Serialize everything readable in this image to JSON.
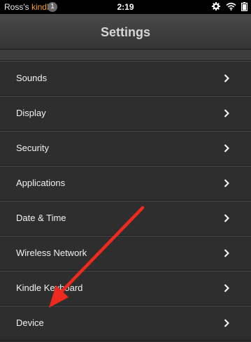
{
  "status_bar": {
    "device_name_prefix": "Ross's ",
    "device_name_brand": "kindle",
    "notification_count": "1",
    "time": "2:19"
  },
  "header": {
    "title": "Settings"
  },
  "settings": {
    "items": [
      {
        "label": "Sounds"
      },
      {
        "label": "Display"
      },
      {
        "label": "Security"
      },
      {
        "label": "Applications"
      },
      {
        "label": "Date & Time"
      },
      {
        "label": "Wireless Network"
      },
      {
        "label": "Kindle Keyboard"
      },
      {
        "label": "Device"
      }
    ]
  },
  "annotation": {
    "arrow_color": "#ee2a1e",
    "points_to": "Device"
  },
  "colors": {
    "brand": "#f0a030",
    "background": "#2b2b2b"
  }
}
